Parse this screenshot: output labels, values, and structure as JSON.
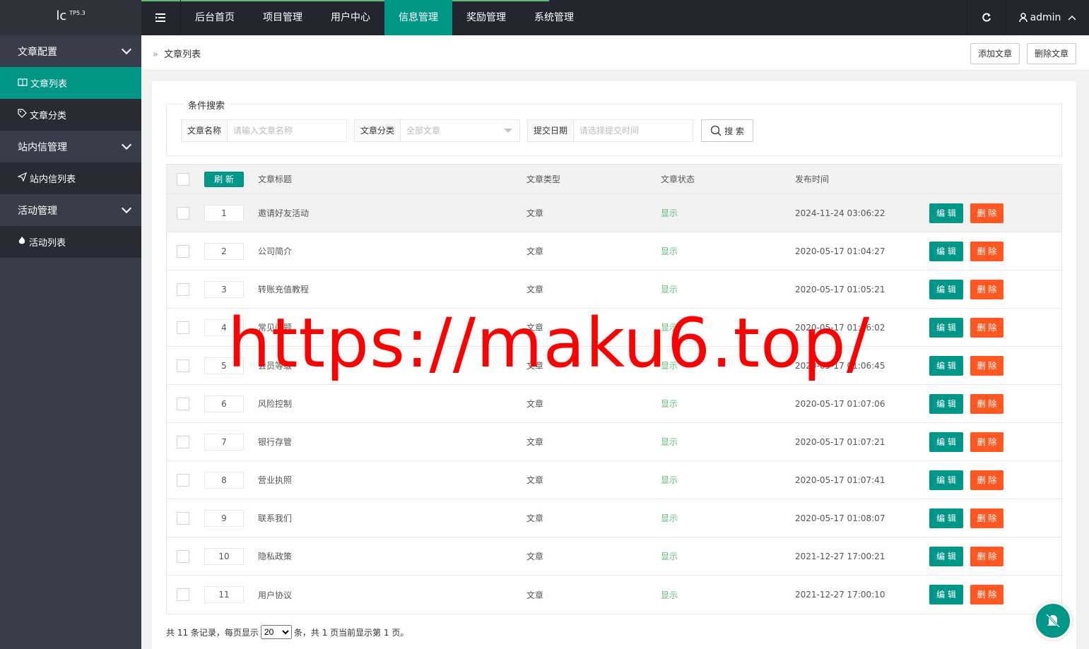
{
  "header": {
    "logo_text": "lc",
    "logo_version": "TP5.3",
    "nav": [
      "后台首页",
      "项目管理",
      "用户中心",
      "信息管理",
      "奖励管理",
      "系统管理"
    ],
    "active_nav": "信息管理",
    "user": "admin"
  },
  "sidebar": {
    "groups": [
      {
        "label": "文章配置",
        "items": [
          {
            "label": "文章列表",
            "icon": "book-icon",
            "active": true
          },
          {
            "label": "文章分类",
            "icon": "tag-icon"
          }
        ]
      },
      {
        "label": "站内信管理",
        "items": [
          {
            "label": "站内信列表",
            "icon": "send-icon"
          }
        ]
      },
      {
        "label": "活动管理",
        "items": [
          {
            "label": "活动列表",
            "icon": "fire-icon"
          }
        ]
      }
    ]
  },
  "breadcrumb": "文章列表",
  "toolbar": {
    "add_label": "添加文章",
    "delete_label": "删除文章"
  },
  "search": {
    "legend": "条件搜索",
    "name_label": "文章名称",
    "name_placeholder": "请输入文章名称",
    "category_label": "文章分类",
    "category_value": "全部文章",
    "date_label": "提交日期",
    "date_placeholder": "请选择提交时间",
    "search_label": "搜 索"
  },
  "table": {
    "refresh_label": "刷 新",
    "headers": [
      "文章标题",
      "文章类型",
      "文章状态",
      "发布时间"
    ],
    "edit_label": "编 辑",
    "delete_label": "删 除",
    "rows": [
      {
        "sort": "1",
        "title": "邀请好友活动",
        "type": "文章",
        "status": "显示",
        "time": "2024-11-24 03:06:22"
      },
      {
        "sort": "2",
        "title": "公司简介",
        "type": "文章",
        "status": "显示",
        "time": "2020-05-17 01:04:27"
      },
      {
        "sort": "3",
        "title": "转账充值教程",
        "type": "文章",
        "status": "显示",
        "time": "2020-05-17 01:05:21"
      },
      {
        "sort": "4",
        "title": "常见问题",
        "type": "文章",
        "status": "显示",
        "time": "2020-05-17 01:06:02"
      },
      {
        "sort": "5",
        "title": "会员等级",
        "type": "文章",
        "status": "显示",
        "time": "2020-05-17 01:06:45"
      },
      {
        "sort": "6",
        "title": "风险控制",
        "type": "文章",
        "status": "显示",
        "time": "2020-05-17 01:07:06"
      },
      {
        "sort": "7",
        "title": "银行存管",
        "type": "文章",
        "status": "显示",
        "time": "2020-05-17 01:07:21"
      },
      {
        "sort": "8",
        "title": "营业执照",
        "type": "文章",
        "status": "显示",
        "time": "2020-05-17 01:07:41"
      },
      {
        "sort": "9",
        "title": "联系我们",
        "type": "文章",
        "status": "显示",
        "time": "2020-05-17 01:08:07"
      },
      {
        "sort": "10",
        "title": "隐私政策",
        "type": "文章",
        "status": "显示",
        "time": "2021-12-27 17:00:21"
      },
      {
        "sort": "11",
        "title": "用户协议",
        "type": "文章",
        "status": "显示",
        "time": "2021-12-27 17:00:10"
      }
    ]
  },
  "footer": {
    "prefix": "共 11 条记录，每页显示",
    "page_size": "20",
    "suffix": "条，共 1 页当前显示第 1 页。"
  },
  "watermark": "https://maku6.top/",
  "colors": {
    "accent": "#009688",
    "danger": "#ff5722",
    "success": "#5fb878",
    "sidebar": "#393d49",
    "topbar": "#23262e"
  }
}
